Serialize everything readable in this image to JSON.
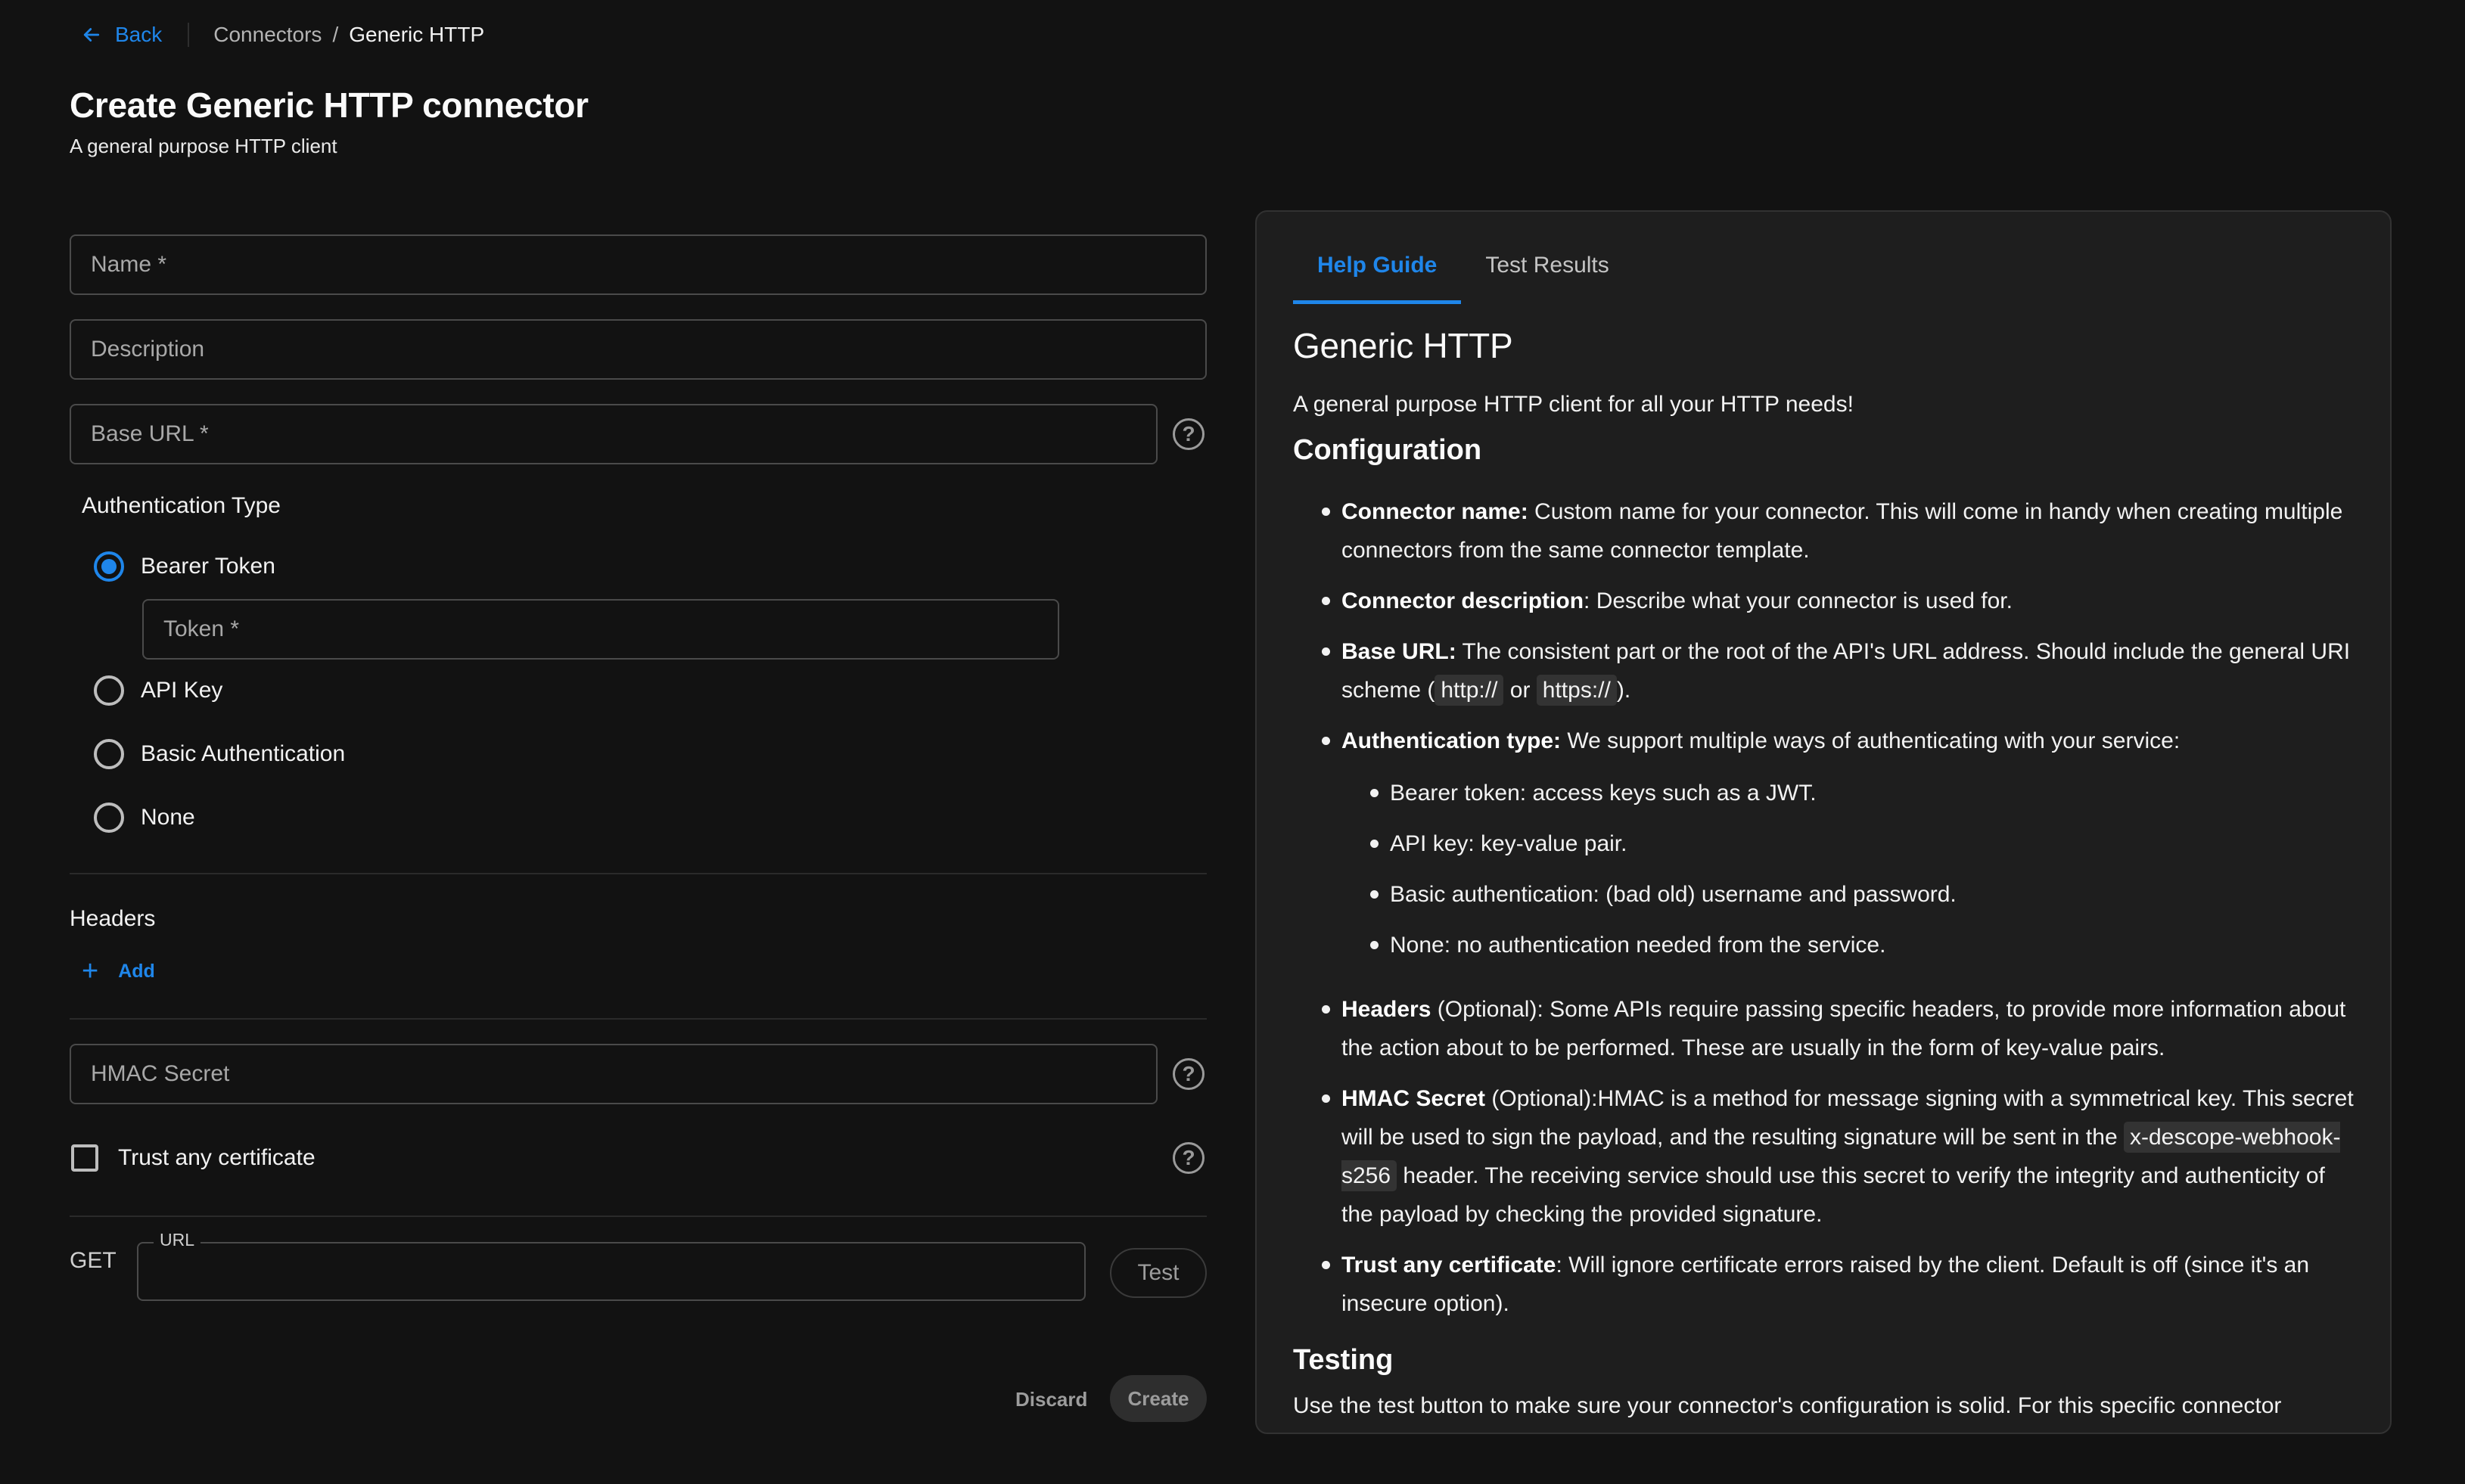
{
  "breadcrumb": {
    "back_label": "Back",
    "items": [
      "Connectors",
      "Generic HTTP"
    ],
    "separator": "/"
  },
  "header": {
    "title": "Create Generic HTTP connector",
    "subtitle": "A general purpose HTTP client"
  },
  "form": {
    "name_placeholder": "Name *",
    "description_placeholder": "Description",
    "base_url_placeholder": "Base URL *",
    "auth_type_label": "Authentication Type",
    "auth_options": [
      {
        "label": "Bearer Token",
        "selected": true
      },
      {
        "label": "API Key",
        "selected": false
      },
      {
        "label": "Basic Authentication",
        "selected": false
      },
      {
        "label": "None",
        "selected": false
      }
    ],
    "token_placeholder": "Token *",
    "headers_label": "Headers",
    "add_label": "Add",
    "hmac_placeholder": "HMAC Secret",
    "trust_certificate_label": "Trust any certificate",
    "trust_certificate_checked": false,
    "test_method": "GET",
    "test_url_label": "URL",
    "test_url_value": "",
    "test_button": "Test",
    "discard_button": "Discard",
    "create_button": "Create",
    "help_icon": "?"
  },
  "panel": {
    "tabs": [
      {
        "label": "Help Guide",
        "active": true
      },
      {
        "label": "Test Results",
        "active": false
      }
    ],
    "title": "Generic HTTP",
    "intro": "A general purpose HTTP client for all your HTTP needs!",
    "configuration_heading": "Configuration",
    "items": {
      "connector_name": {
        "term": "Connector name:",
        "text": " Custom name for your connector. This will come in handy when creating multiple connectors from the same connector template."
      },
      "connector_description": {
        "term": "Connector description",
        "text": ": Describe what your connector is used for."
      },
      "base_url": {
        "term": "Base URL:",
        "text_before": " The consistent part or the root of the API's URL address. Should include the general URI scheme (",
        "code1": "http://",
        "text_mid": " or ",
        "code2": "https://",
        "text_after": ")."
      },
      "auth_type": {
        "term": "Authentication type:",
        "text": " We support multiple ways of authenticating with your service:"
      },
      "auth_sub": [
        "Bearer token: access keys such as a JWT.",
        "API key: key-value pair.",
        "Basic authentication: (bad old) username and password.",
        "None: no authentication needed from the service."
      ],
      "headers": {
        "term": "Headers",
        "text": " (Optional): Some APIs require passing specific headers, to provide more information about the action about to be performed. These are usually in the form of key-value pairs."
      },
      "hmac": {
        "term": "HMAC Secret",
        "text_before": " (Optional):HMAC is a method for message signing with a symmetrical key. This secret will be used to sign the payload, and the resulting signature will be sent in the ",
        "code": "x-descope-webhook-s256",
        "text_after": " header. The receiving service should use this secret to verify the integrity and authenticity of the payload by checking the provided signature."
      },
      "trust": {
        "term": "Trust any certificate",
        "text": ": Will ignore certificate errors raised by the client. Default is off (since it's an insecure option)."
      }
    },
    "testing_heading": "Testing",
    "testing_text": "Use the test button to make sure your connector's configuration is solid. For this specific connector"
  },
  "colors": {
    "accent": "#1f86ea",
    "background": "#121212",
    "panel": "#1e1e1e"
  }
}
